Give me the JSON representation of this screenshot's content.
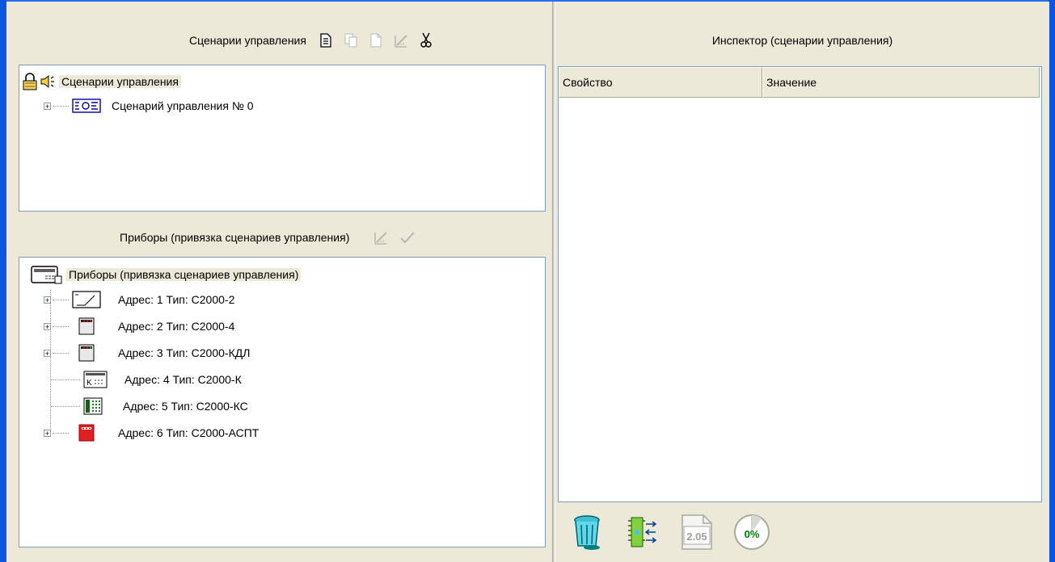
{
  "scenarios": {
    "title": "Сценарии управления",
    "toolbar": [
      "new-document-icon",
      "copy-icon",
      "paste-icon",
      "edit-ruler-icon",
      "cut-icon"
    ],
    "root_label": "Сценарии управления",
    "items": [
      {
        "label": "Сценарий управления № 0"
      }
    ]
  },
  "devices": {
    "title": "Приборы  (привязка сценариев управления)",
    "toolbar": [
      "edit-ruler-icon",
      "apply-check-icon"
    ],
    "root_label": "Приборы (привязка сценариев управления)",
    "items": [
      {
        "label": "Адрес: 1 Тип: С2000-2",
        "expandable": true,
        "icon": "device-c2000-2-icon"
      },
      {
        "label": "Адрес: 2 Тип: С2000-4",
        "expandable": true,
        "icon": "device-c2000-4-icon"
      },
      {
        "label": "Адрес: 3 Тип: С2000-КДЛ",
        "expandable": true,
        "icon": "device-c2000-kdl-icon"
      },
      {
        "label": "Адрес: 4 Тип: С2000-К",
        "expandable": false,
        "icon": "device-c2000-k-icon"
      },
      {
        "label": "Адрес: 5 Тип: С2000-КС",
        "expandable": false,
        "icon": "device-c2000-ks-icon"
      },
      {
        "label": "Адрес: 6 Тип: С2000-АСПТ",
        "expandable": true,
        "icon": "device-c2000-aspt-icon"
      }
    ]
  },
  "inspector": {
    "title": "Инспектор (сценарии управления)",
    "columns": [
      "Свойство",
      "Значение"
    ]
  },
  "bottom_toolbar": {
    "version_label": "2.05",
    "progress_label": "0%"
  },
  "colors": {
    "window_frame": "#0a55e0",
    "panel_bg": "#ece9d8",
    "tree_border": "#7f9db9",
    "aspt_red": "#e02020",
    "progress_green": "#008000"
  }
}
